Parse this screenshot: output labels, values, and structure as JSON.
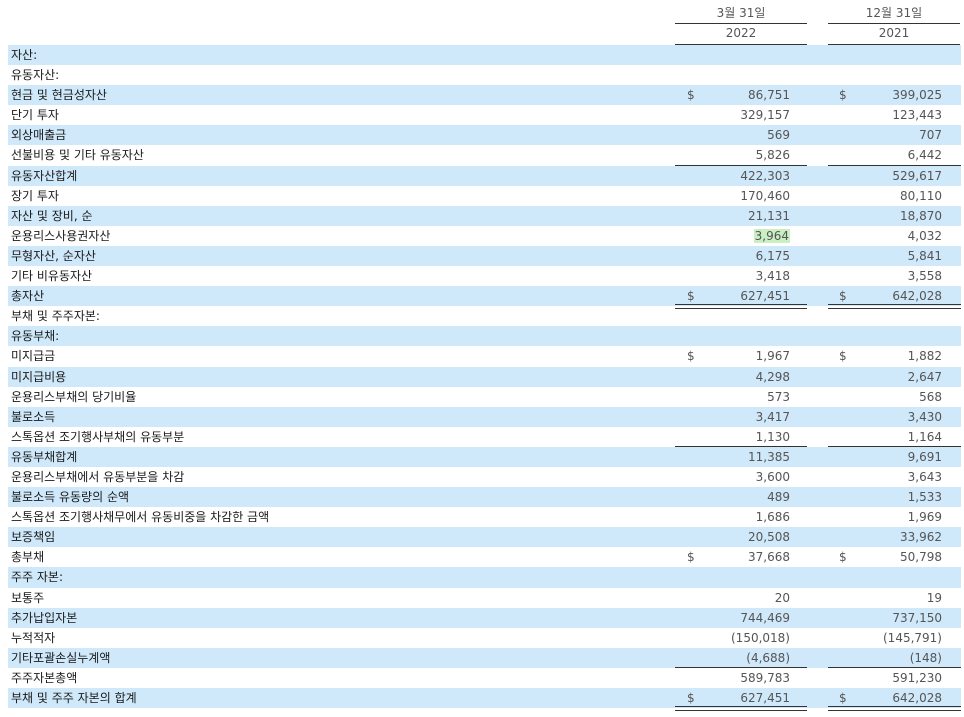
{
  "header": {
    "col1_period": "3월 31일",
    "col1_year": "2022",
    "col2_period": "12월 31일",
    "col2_year": "2021"
  },
  "rows": [
    {
      "label": "자산:",
      "cur1": "",
      "v1": "",
      "cur2": "",
      "v2": ""
    },
    {
      "label": "유동자산:",
      "cur1": "",
      "v1": "",
      "cur2": "",
      "v2": ""
    },
    {
      "label": "현금 및 현금성자산",
      "cur1": "$",
      "v1": "86,751",
      "cur2": "$",
      "v2": "399,025"
    },
    {
      "label": "단기 투자",
      "cur1": "",
      "v1": "329,157",
      "cur2": "",
      "v2": "123,443"
    },
    {
      "label": "외상매출금",
      "cur1": "",
      "v1": "569",
      "cur2": "",
      "v2": "707"
    },
    {
      "label": "선불비용 및 기타 유동자산",
      "cur1": "",
      "v1": "5,826",
      "cur2": "",
      "v2": "6,442"
    },
    {
      "label": "유동자산합계",
      "cur1": "",
      "v1": "422,303",
      "cur2": "",
      "v2": "529,617"
    },
    {
      "label": "장기 투자",
      "cur1": "",
      "v1": "170,460",
      "cur2": "",
      "v2": "80,110"
    },
    {
      "label": "자산 및 장비, 순",
      "cur1": "",
      "v1": "21,131",
      "cur2": "",
      "v2": "18,870"
    },
    {
      "label": "운용리스사용권자산",
      "cur1": "",
      "v1": "3,964",
      "cur2": "",
      "v2": "4,032"
    },
    {
      "label": "무형자산, 순자산",
      "cur1": "",
      "v1": "6,175",
      "cur2": "",
      "v2": "5,841"
    },
    {
      "label": "기타 비유동자산",
      "cur1": "",
      "v1": "3,418",
      "cur2": "",
      "v2": "3,558"
    },
    {
      "label": "총자산",
      "cur1": "$",
      "v1": "627,451",
      "cur2": "$",
      "v2": "642,028"
    },
    {
      "label": "부채 및 주주자본:",
      "cur1": "",
      "v1": "",
      "cur2": "",
      "v2": ""
    },
    {
      "label": "유동부채:",
      "cur1": "",
      "v1": "",
      "cur2": "",
      "v2": ""
    },
    {
      "label": "미지급금",
      "cur1": "$",
      "v1": "1,967",
      "cur2": "$",
      "v2": "1,882"
    },
    {
      "label": "미지급비용",
      "cur1": "",
      "v1": "4,298",
      "cur2": "",
      "v2": "2,647"
    },
    {
      "label": "운용리스부채의 당기비율",
      "cur1": "",
      "v1": "573",
      "cur2": "",
      "v2": "568"
    },
    {
      "label": "불로소득",
      "cur1": "",
      "v1": "3,417",
      "cur2": "",
      "v2": "3,430"
    },
    {
      "label": "스톡옵션 조기행사부채의 유동부분",
      "cur1": "",
      "v1": "1,130",
      "cur2": "",
      "v2": "1,164"
    },
    {
      "label": "유동부채합계",
      "cur1": "",
      "v1": "11,385",
      "cur2": "",
      "v2": "9,691"
    },
    {
      "label": "운용리스부채에서 유동부분을 차감",
      "cur1": "",
      "v1": "3,600",
      "cur2": "",
      "v2": "3,643"
    },
    {
      "label": "불로소득 유동량의 순액",
      "cur1": "",
      "v1": "489",
      "cur2": "",
      "v2": "1,533"
    },
    {
      "label": "스톡옵션 조기행사채무에서 유동비중을 차감한 금액",
      "cur1": "",
      "v1": "1,686",
      "cur2": "",
      "v2": "1,969"
    },
    {
      "label": "보증책임",
      "cur1": "",
      "v1": "20,508",
      "cur2": "",
      "v2": "33,962"
    },
    {
      "label": "총부채",
      "cur1": "$",
      "v1": "37,668",
      "cur2": "$",
      "v2": "50,798"
    },
    {
      "label": "주주 자본:",
      "cur1": "",
      "v1": "",
      "cur2": "",
      "v2": ""
    },
    {
      "label": "보통주",
      "cur1": "",
      "v1": "20",
      "cur2": "",
      "v2": "19"
    },
    {
      "label": "추가납입자본",
      "cur1": "",
      "v1": "744,469",
      "cur2": "",
      "v2": "737,150"
    },
    {
      "label": "누적적자",
      "cur1": "",
      "v1": "(150,018)",
      "cur2": "",
      "v2": "(145,791)"
    },
    {
      "label": "기타포괄손실누계액",
      "cur1": "",
      "v1": "(4,688)",
      "cur2": "",
      "v2": "(148)"
    },
    {
      "label": "주주자본총액",
      "cur1": "",
      "v1": "589,783",
      "cur2": "",
      "v2": "591,230"
    },
    {
      "label": "부채 및 주주 자본의 합계",
      "cur1": "$",
      "v1": "627,451",
      "cur2": "$",
      "v2": "642,028"
    }
  ]
}
